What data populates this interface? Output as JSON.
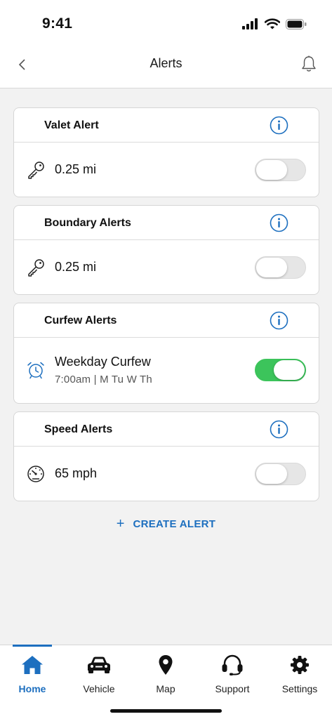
{
  "status_bar": {
    "time": "9:41"
  },
  "header": {
    "title": "Alerts"
  },
  "cards": [
    {
      "title": "Valet Alert",
      "value": "0.25 mi",
      "sub": "",
      "icon": "key-icon",
      "enabled": false
    },
    {
      "title": "Boundary Alerts",
      "value": "0.25 mi",
      "sub": "",
      "icon": "key-icon",
      "enabled": false
    },
    {
      "title": "Curfew Alerts",
      "value": "Weekday Curfew",
      "sub": "7:00am | M Tu W Th",
      "icon": "alarm-clock-icon",
      "enabled": true
    },
    {
      "title": "Speed Alerts",
      "value": "65 mph",
      "sub": "",
      "icon": "speedometer-icon",
      "enabled": false
    }
  ],
  "create_alert": {
    "plus": "+",
    "label": "CREATE ALERT"
  },
  "tabs": [
    {
      "label": "Home",
      "icon": "home-icon",
      "active": true
    },
    {
      "label": "Vehicle",
      "icon": "car-icon",
      "active": false
    },
    {
      "label": "Map",
      "icon": "map-pin-icon",
      "active": false
    },
    {
      "label": "Support",
      "icon": "headset-icon",
      "active": false
    },
    {
      "label": "Settings",
      "icon": "gear-icon",
      "active": false
    }
  ],
  "colors": {
    "accent": "#1d6fbf",
    "toggle_on": "#3cc45b",
    "background": "#f2f2f2"
  }
}
